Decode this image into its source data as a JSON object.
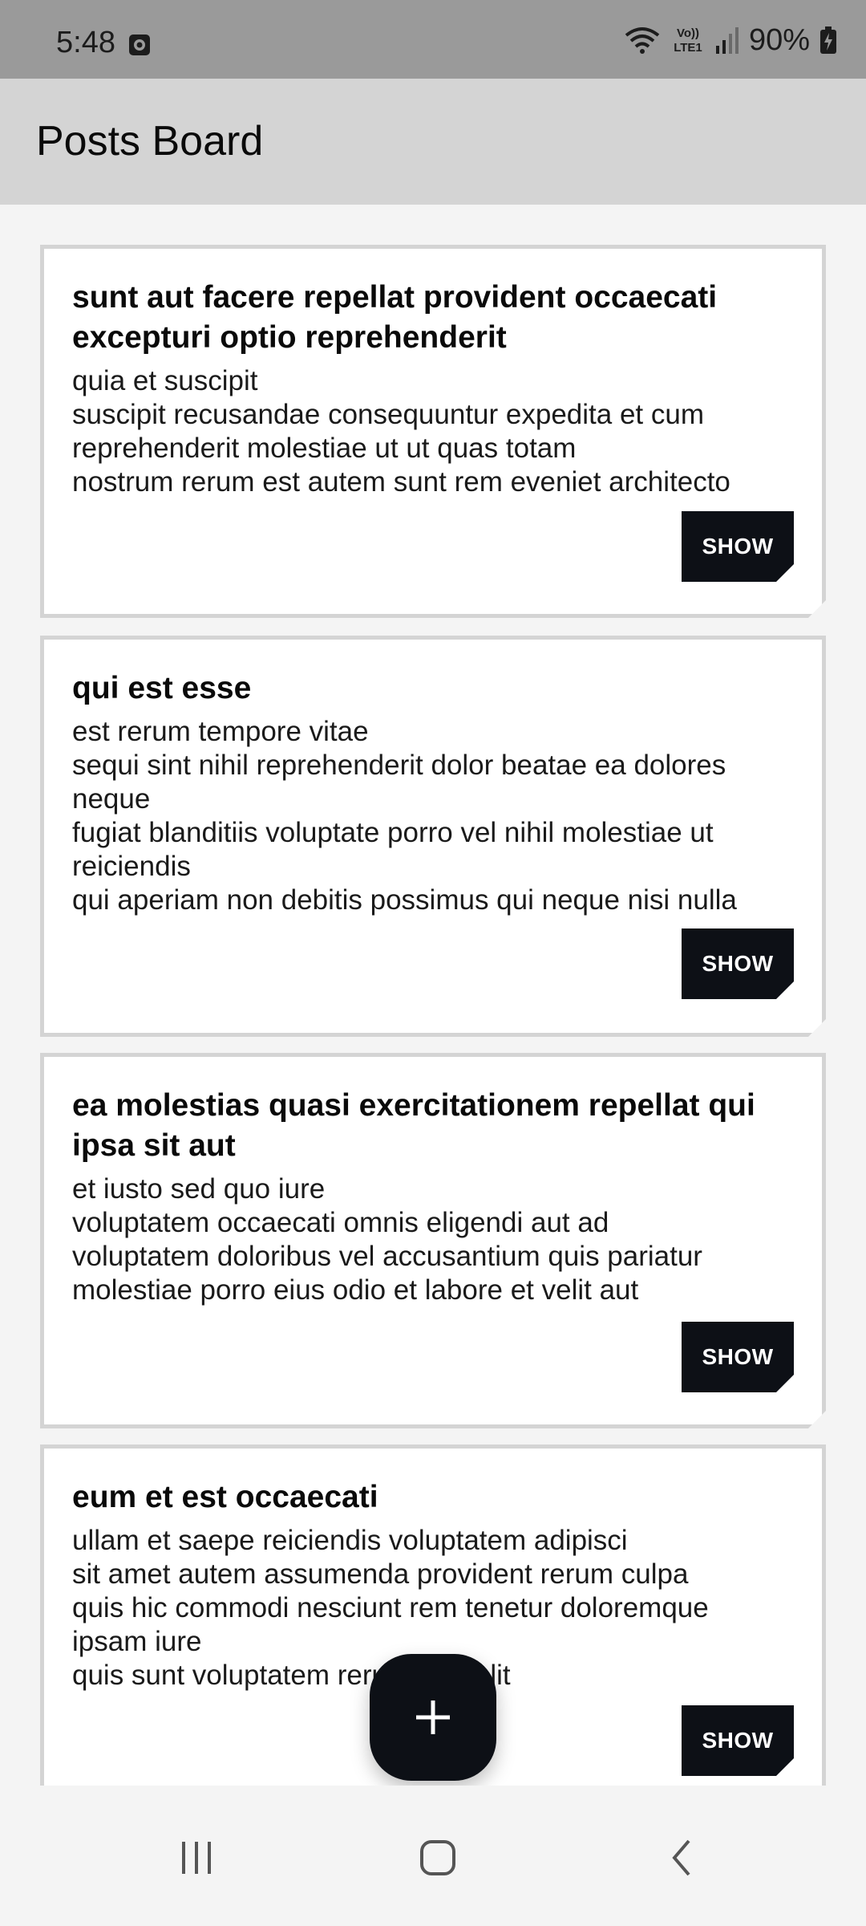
{
  "status_bar": {
    "time": "5:48",
    "battery_percent": "90%",
    "icons": [
      "screen-record-icon",
      "wifi-icon",
      "volte-lte-icon",
      "signal-icon",
      "battery-charging-icon"
    ],
    "volte_label_top": "Vo))",
    "volte_label_bottom": "LTE1"
  },
  "app_bar": {
    "title": "Posts Board"
  },
  "posts": [
    {
      "title": "sunt aut facere repellat provident occaecati excepturi optio reprehenderit",
      "body": "quia et suscipit\nsuscipit recusandae consequuntur expedita et cum\nreprehenderit molestiae ut ut quas totam\nnostrum rerum est autem sunt rem eveniet architecto",
      "button_label": "SHOW"
    },
    {
      "title": "qui est esse",
      "body": "est rerum tempore vitae\nsequi sint nihil reprehenderit dolor beatae ea dolores\nneque\nfugiat blanditiis voluptate porro vel nihil molestiae ut\nreiciendis\nqui aperiam non debitis possimus qui neque nisi nulla",
      "button_label": "SHOW"
    },
    {
      "title": "ea molestias quasi exercitationem repellat qui ipsa sit aut",
      "body": "et iusto sed quo iure\nvoluptatem occaecati omnis eligendi aut ad\nvoluptatem doloribus vel accusantium quis pariatur\nmolestiae porro eius odio et labore et velit aut",
      "button_label": "SHOW"
    },
    {
      "title": "eum et est occaecati",
      "body": "ullam et saepe reiciendis voluptatem adipisci\nsit amet autem assumenda provident rerum culpa\nquis hic commodi nesciunt rem tenetur doloremque\nipsam iure\nquis sunt voluptatem rerum illo velit",
      "button_label": "SHOW"
    }
  ],
  "fab": {
    "icon": "plus-icon"
  },
  "nav_bar": {
    "icons": [
      "recent-apps-icon",
      "home-icon",
      "back-icon"
    ]
  },
  "colors": {
    "status_bar_bg": "#9a9a9a",
    "app_bar_bg": "#d4d4d4",
    "page_bg": "#f4f4f4",
    "card_bg": "#ffffff",
    "card_border": "#d4d4d4",
    "button_bg": "#0d1016",
    "button_text": "#ffffff"
  }
}
